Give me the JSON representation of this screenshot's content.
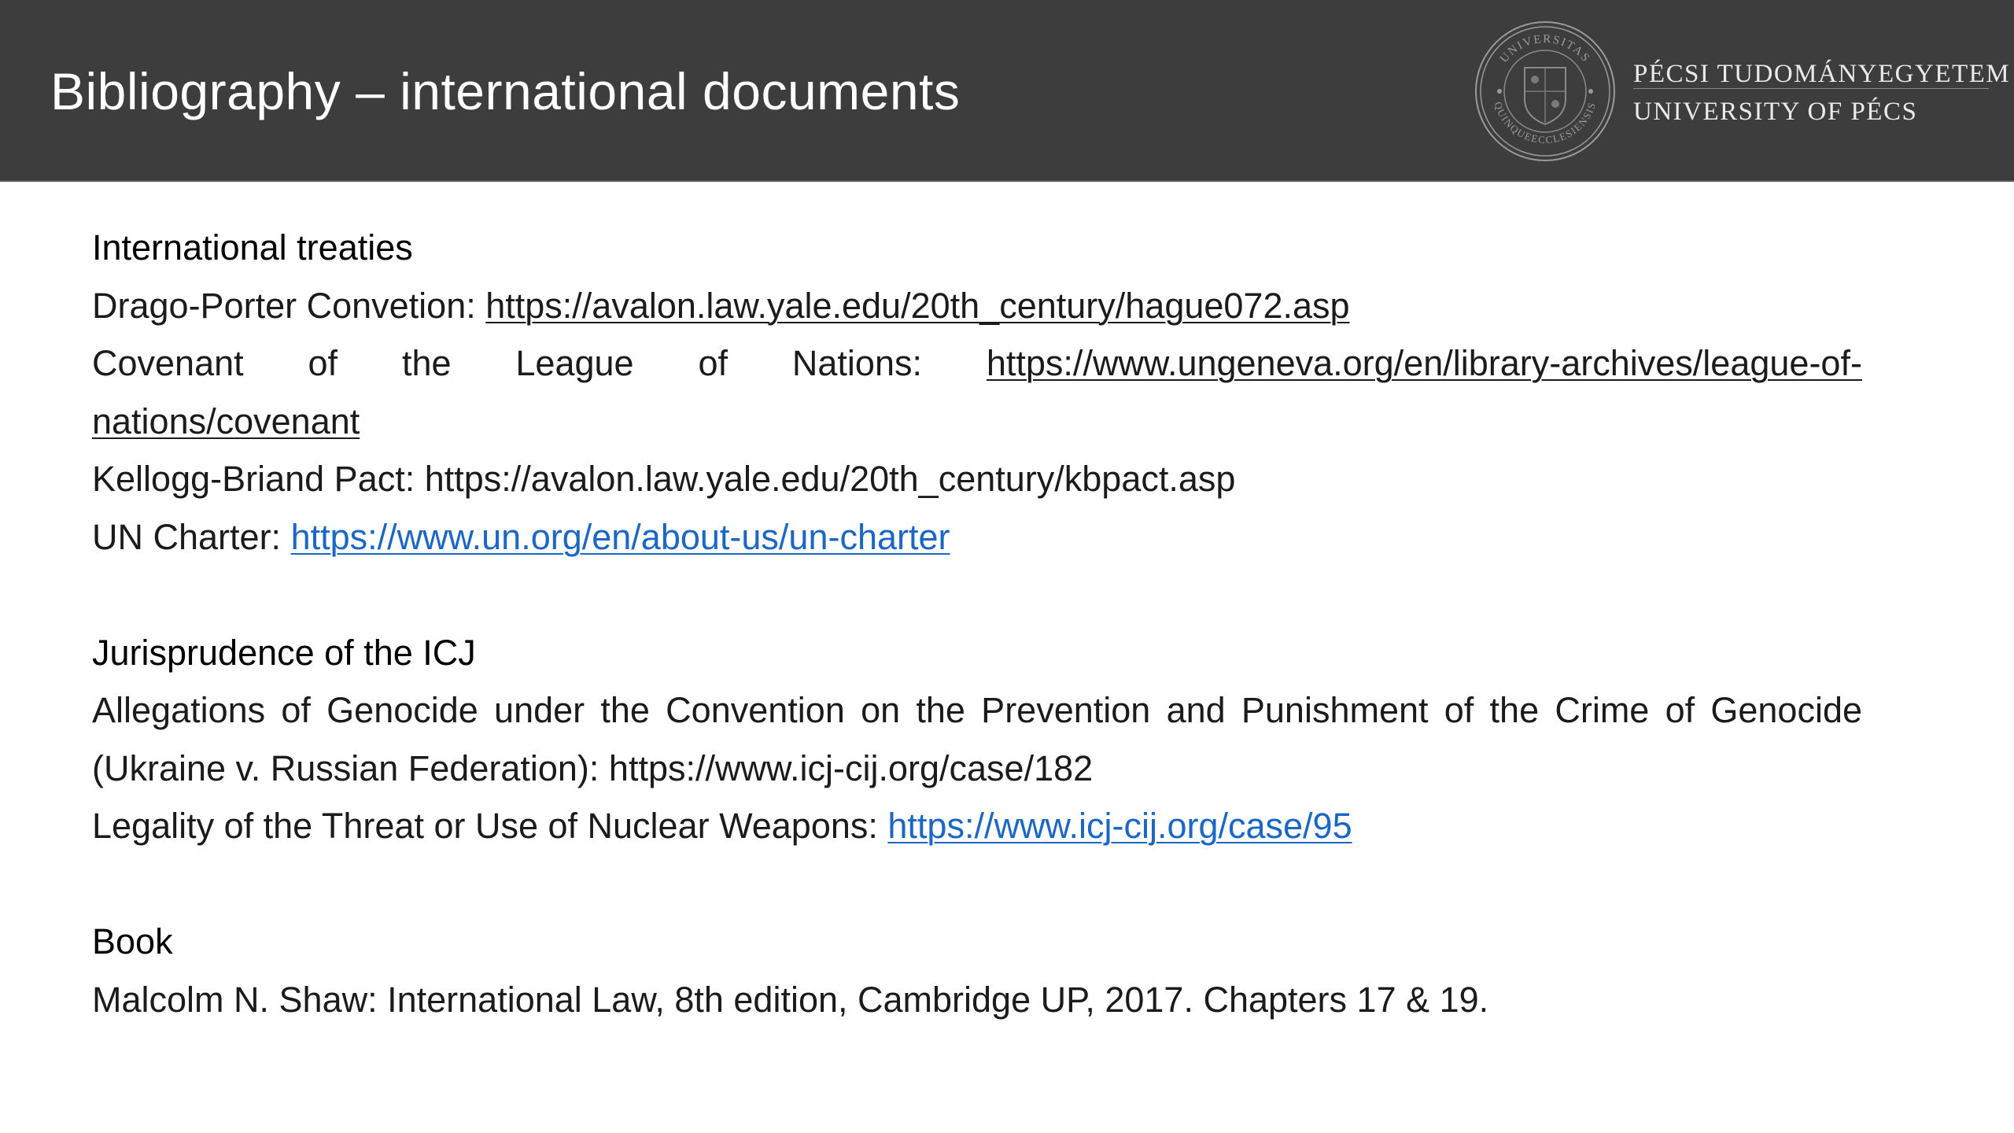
{
  "header": {
    "title": "Bibliography – international documents",
    "university": {
      "name_hu": "PÉCSI TUDOMÁNYEGYETEM",
      "name_en": "UNIVERSITY OF PÉCS",
      "seal_text": "UNIVERSITAS QUINQUEECCLESIENSIS",
      "logo_icon": "university-seal-icon"
    }
  },
  "sections": {
    "treaties": {
      "heading": "International treaties",
      "items": [
        {
          "label": "Drago-Porter Convetion: ",
          "url": "https://avalon.law.yale.edu/20th_century/hague072.asp"
        },
        {
          "label_words": [
            "Covenant",
            "of",
            "the",
            "League",
            "of",
            "Nations:"
          ],
          "url_line1": "https://www.ungeneva.org/en/library-archives/league-of-",
          "url_line2": "nations/covenant"
        },
        {
          "label": "Kellogg-Briand Pact: ",
          "text": "https://avalon.law.yale.edu/20th_century/kbpact.asp"
        },
        {
          "label": "UN Charter: ",
          "url": "https://www.un.org/en/about-us/un-charter"
        }
      ]
    },
    "icj": {
      "heading": "Jurisprudence of the ICJ",
      "items": [
        {
          "text": "Allegations of Genocide under the Convention on the Prevention and Punishment of the Crime of Genocide (Ukraine v. Russian Federation): https://www.icj-cij.org/case/182"
        },
        {
          "label": "Legality of the Threat or Use of Nuclear Weapons: ",
          "url": "https://www.icj-cij.org/case/95"
        }
      ]
    },
    "book": {
      "heading": "Book",
      "items": [
        {
          "text": "Malcolm N. Shaw: International Law, 8th edition, Cambridge UP, 2017. Chapters 17 & 19."
        }
      ]
    }
  },
  "colors": {
    "header_bg": "#3d3d3d",
    "link_blue": "#1a67c7",
    "text": "#1b1b1b"
  }
}
